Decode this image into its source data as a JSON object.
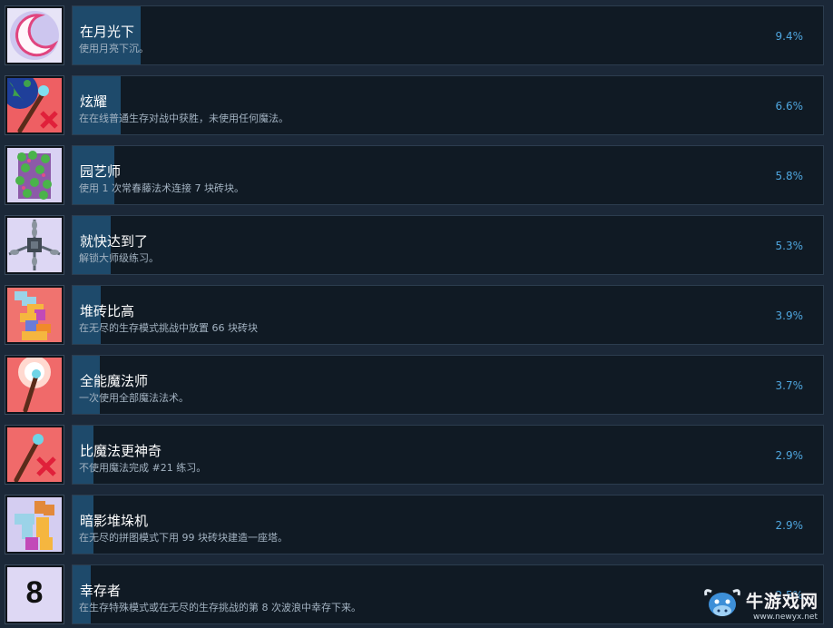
{
  "achievements": [
    {
      "title": "在月光下",
      "desc": "使用月亮下沉。",
      "percent": "9.4%",
      "progress": 9.4,
      "icon": "crescent-moon-icon"
    },
    {
      "title": "炫耀",
      "desc": "在在线普通生存对战中获胜，未使用任何魔法。",
      "percent": "6.6%",
      "progress": 6.6,
      "icon": "no-magic-globe-icon"
    },
    {
      "title": "园艺师",
      "desc": "使用 1 次常春藤法术连接 7 块砖块。",
      "percent": "5.8%",
      "progress": 5.8,
      "icon": "ivy-bricks-icon"
    },
    {
      "title": "就快达到了",
      "desc": "解锁大师级练习。",
      "percent": "5.3%",
      "progress": 5.3,
      "icon": "chained-block-icon"
    },
    {
      "title": "堆砖比高",
      "desc": "在无尽的生存模式挑战中放置 66 块砖块",
      "percent": "3.9%",
      "progress": 3.9,
      "icon": "brick-tower-icon"
    },
    {
      "title": "全能魔法师",
      "desc": "一次使用全部魔法法术。",
      "percent": "3.7%",
      "progress": 3.7,
      "icon": "glowing-wand-icon"
    },
    {
      "title": "比魔法更神奇",
      "desc": "不使用魔法完成 #21 练习。",
      "percent": "2.9%",
      "progress": 2.9,
      "icon": "crossed-wand-icon"
    },
    {
      "title": "暗影堆垛机",
      "desc": "在无尽的拼图模式下用 99 块砖块建造一座塔。",
      "percent": "2.9%",
      "progress": 2.9,
      "icon": "shadow-stack-icon"
    },
    {
      "title": "幸存者",
      "desc": "在生存特殊模式或在无尽的生存挑战的第 8 次波浪中幸存下来。",
      "percent": "2.5%",
      "progress": 2.5,
      "icon": "number-eight-icon",
      "icon_text": "8"
    }
  ],
  "watermark": {
    "text": "牛游戏网",
    "url": "www.newyx.net",
    "icon": "cow-logo-icon"
  }
}
